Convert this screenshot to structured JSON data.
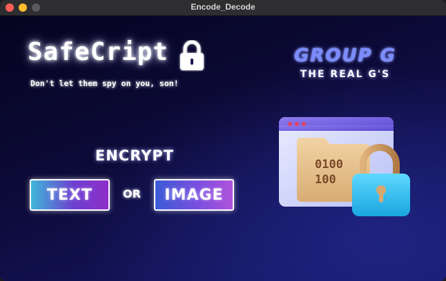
{
  "window": {
    "title": "Encode_Decode"
  },
  "brand": {
    "name": "SafeCript",
    "tagline": "Don't let them spy on you, son!"
  },
  "group": {
    "title": "GROUP G",
    "subtitle": "THE REAL G'S"
  },
  "actions": {
    "heading": "ENCRYPT",
    "text_button": "TEXT",
    "or_label": "OR",
    "image_button": "IMAGE"
  },
  "illustration": {
    "binary_line1": "0100",
    "binary_line2": "100"
  },
  "icons": {
    "brand_lock": "lock-icon",
    "illustration": "padlock-folder-window-icon"
  },
  "colors": {
    "background_dark": "#050420",
    "background_light": "#181a6e",
    "group_accent": "#7a8cff",
    "lock_blue": "#3fc6f2"
  }
}
